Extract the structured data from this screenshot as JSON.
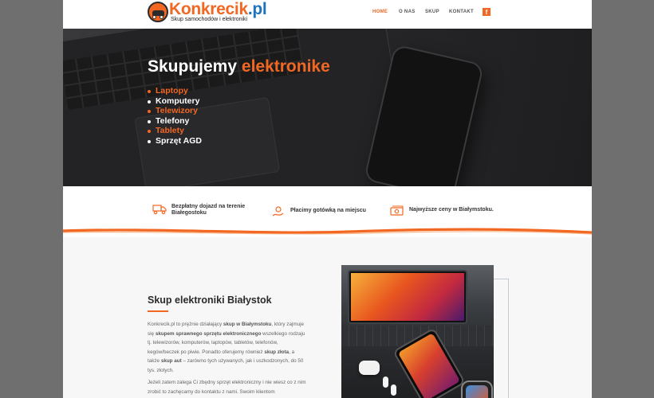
{
  "header": {
    "logo": {
      "name": "Konkrecik",
      "tld": ".pl",
      "tagline": "Skup samochodów i elektroniki"
    },
    "nav": [
      {
        "label": "HOME",
        "active": true
      },
      {
        "label": "O NAS",
        "active": false
      },
      {
        "label": "SKUP",
        "active": false
      },
      {
        "label": "KONTAKT",
        "active": false
      }
    ],
    "social_icon": "f"
  },
  "hero": {
    "title_white": "Skupujemy",
    "title_accent": "elektronike",
    "items": [
      {
        "label": "Laptopy",
        "color": "#f26722"
      },
      {
        "label": "Komputery",
        "color": "#ffffff"
      },
      {
        "label": "Telewizory",
        "color": "#f26722"
      },
      {
        "label": "Telefony",
        "color": "#ffffff"
      },
      {
        "label": "Tablety",
        "color": "#f26722"
      },
      {
        "label": "Sprzęt AGD",
        "color": "#ffffff"
      }
    ]
  },
  "features": [
    {
      "icon": "truck-icon",
      "line1": "Bezpłatny dojazd na terenie",
      "line2": "Białegostoku"
    },
    {
      "icon": "cash-hand-icon",
      "line1": "Płacimy gotówką na miejscu",
      "line2": ""
    },
    {
      "icon": "money-icon",
      "line1": "Najwyższe ceny w Białymstoku.",
      "line2": ""
    }
  ],
  "content": {
    "title": "Skup elektroniki Białystok",
    "p1": [
      {
        "t": "Konkrecik.pl to prężnie działający ",
        "b": false
      },
      {
        "t": "skup w Białymstoku",
        "b": true
      },
      {
        "t": ", który zajmuje się ",
        "b": false
      },
      {
        "t": "skupem sprawnego sprzętu elektronicznego",
        "b": true
      },
      {
        "t": " wszelkiego rodzaju tj. telewizorów, komputerów, laptopów, tabletów, telefonów, kegów/beczek po piwie. Ponadto oferujemy również ",
        "b": false
      },
      {
        "t": "skup złota",
        "b": true
      },
      {
        "t": ", a także ",
        "b": false
      },
      {
        "t": "skup aut",
        "b": true
      },
      {
        "t": " – zarówno tych używanych, jak i uszkodzonych, do 50 tys. złotych.",
        "b": false
      }
    ],
    "p2": "Jeżeli zatem zalega Ci zbędny sprzęt elektroniczny i nie wiesz co z nim zrobić to zachęcamy do kontaktu z nami. Swoim klientom"
  },
  "colors": {
    "accent": "#f26722",
    "link": "#1e73be",
    "dark": "#2b2b2b"
  }
}
